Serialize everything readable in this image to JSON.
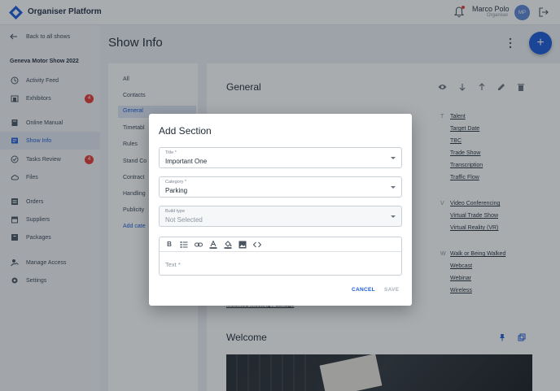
{
  "app": {
    "title": "Organiser Platform"
  },
  "user": {
    "name": "Marco Polo",
    "role": "Organiser",
    "initials": "MP"
  },
  "sidebar": {
    "back_label": "Back to all shows",
    "show_name": "Geneva Motor Show 2022",
    "items": [
      {
        "label": "Activity Feed",
        "icon": "activity-icon"
      },
      {
        "label": "Exhibitors",
        "icon": "exhibitors-icon",
        "badge": "4"
      },
      {
        "label": "Online Manual",
        "icon": "book-icon"
      },
      {
        "label": "Show Info",
        "icon": "show-info-icon",
        "active": true
      },
      {
        "label": "Tasks Review",
        "icon": "check-circle-icon",
        "badge": "4"
      },
      {
        "label": "Files",
        "icon": "cloud-icon"
      },
      {
        "label": "Orders",
        "icon": "orders-icon"
      },
      {
        "label": "Suppliers",
        "icon": "store-icon"
      },
      {
        "label": "Packages",
        "icon": "package-icon"
      },
      {
        "label": "Manage Access",
        "icon": "person-key-icon"
      },
      {
        "label": "Settings",
        "icon": "gear-icon"
      }
    ]
  },
  "page": {
    "title": "Show Info"
  },
  "categories": {
    "items": [
      "All",
      "Contacts",
      "General",
      "Timetabl",
      "Rules",
      "Stand Co",
      "Contract",
      "Handling",
      "Publicity"
    ],
    "add_label": "Add cate"
  },
  "sections": {
    "general_title": "General",
    "general_letters": [
      "T",
      "V",
      "W"
    ],
    "general_links_t": [
      "Talent",
      "Target Date",
      "TBC",
      "Trade Show",
      "Transcription",
      "Traffic Flow"
    ],
    "general_links_v": [
      "Video Conferencing",
      "Virtual Trade Show",
      "Virtual Reality (VR)"
    ],
    "general_links_w": [
      "Walk or Being Walked",
      "Webcast",
      "Webinar",
      "Wireless"
    ],
    "left_partial": "Mounted Meeting Package",
    "welcome_title": "Welcome"
  },
  "dialog": {
    "title": "Add Section",
    "title_field": {
      "label": "Title *",
      "value": "Important One"
    },
    "category_field": {
      "label": "Category *",
      "value": "Parking"
    },
    "build_type_field": {
      "label": "Build type",
      "value": "Not Selected"
    },
    "editor_placeholder": "Text *",
    "cancel_label": "CANCEL",
    "save_label": "SAVE"
  },
  "colors": {
    "accent": "#1a5ad7",
    "badge": "#e53935",
    "overlay": "rgba(30,36,44,0.38)"
  }
}
